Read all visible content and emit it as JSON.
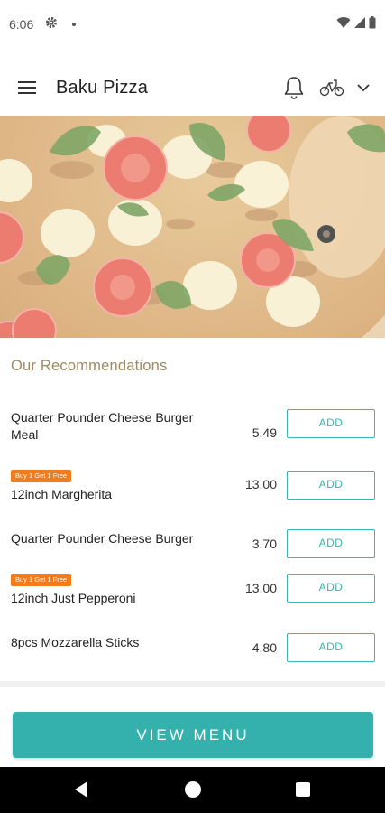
{
  "status_bar": {
    "time": "6:06",
    "icons": [
      "gear-icon",
      "dot-icon",
      "wifi-icon",
      "signal-icon",
      "battery-icon"
    ]
  },
  "app_bar": {
    "title": "Baku Pizza",
    "icons": [
      "menu-icon",
      "bell-icon",
      "scooter-icon",
      "chevron-down-icon"
    ]
  },
  "hero": {
    "image": "pizza-photo"
  },
  "recommendations": {
    "title": "Our Recommendations",
    "add_label": "ADD",
    "items": [
      {
        "name": "Quarter Pounder Cheese Burger Meal",
        "price": "5.49",
        "promo": ""
      },
      {
        "name": "12inch Margherita",
        "price": "13.00",
        "promo": "Buy 1 Get 1 Free"
      },
      {
        "name": "Quarter Pounder Cheese Burger",
        "price": "3.70",
        "promo": ""
      },
      {
        "name": "12inch Just Pepperoni",
        "price": "13.00",
        "promo": "Buy 1 Get 1 Free"
      },
      {
        "name": "8pcs Mozzarella Sticks",
        "price": "4.80",
        "promo": ""
      }
    ]
  },
  "footer": {
    "view_menu_label": "VIEW MENU"
  },
  "colors": {
    "accent": "#35b1ad",
    "section_title": "#9c8a62",
    "promo": "#f07c1e"
  },
  "nav_bar": {
    "icons": [
      "back-icon",
      "home-icon",
      "recents-icon"
    ]
  }
}
